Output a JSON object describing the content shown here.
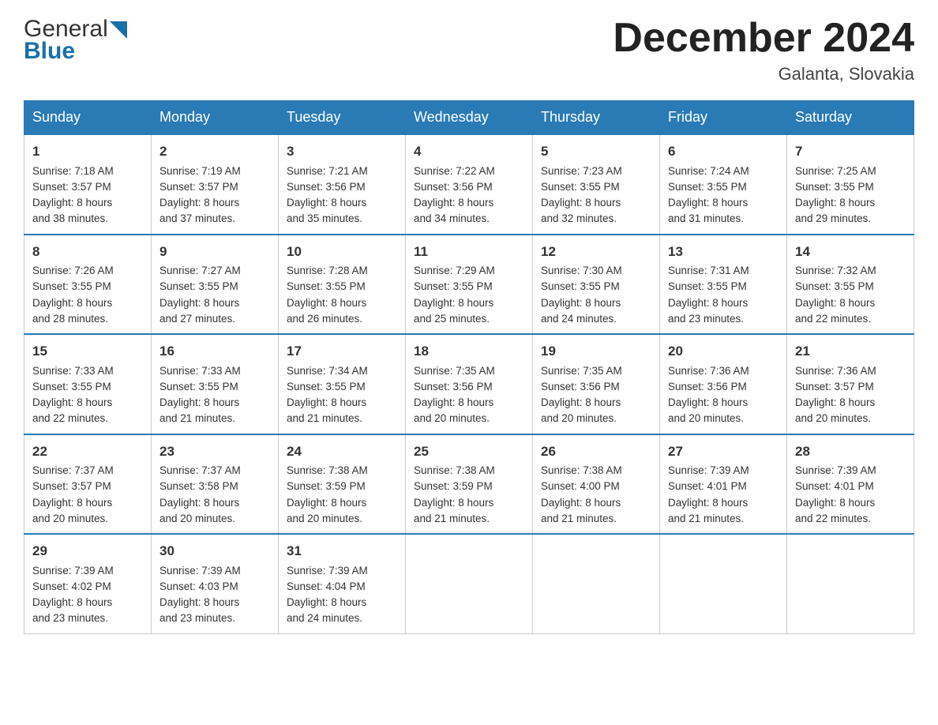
{
  "header": {
    "logo_general": "General",
    "logo_blue": "Blue",
    "month_title": "December 2024",
    "location": "Galanta, Slovakia"
  },
  "weekdays": [
    "Sunday",
    "Monday",
    "Tuesday",
    "Wednesday",
    "Thursday",
    "Friday",
    "Saturday"
  ],
  "weeks": [
    [
      {
        "day": "1",
        "sunrise": "7:18 AM",
        "sunset": "3:57 PM",
        "daylight": "8 hours and 38 minutes."
      },
      {
        "day": "2",
        "sunrise": "7:19 AM",
        "sunset": "3:57 PM",
        "daylight": "8 hours and 37 minutes."
      },
      {
        "day": "3",
        "sunrise": "7:21 AM",
        "sunset": "3:56 PM",
        "daylight": "8 hours and 35 minutes."
      },
      {
        "day": "4",
        "sunrise": "7:22 AM",
        "sunset": "3:56 PM",
        "daylight": "8 hours and 34 minutes."
      },
      {
        "day": "5",
        "sunrise": "7:23 AM",
        "sunset": "3:55 PM",
        "daylight": "8 hours and 32 minutes."
      },
      {
        "day": "6",
        "sunrise": "7:24 AM",
        "sunset": "3:55 PM",
        "daylight": "8 hours and 31 minutes."
      },
      {
        "day": "7",
        "sunrise": "7:25 AM",
        "sunset": "3:55 PM",
        "daylight": "8 hours and 29 minutes."
      }
    ],
    [
      {
        "day": "8",
        "sunrise": "7:26 AM",
        "sunset": "3:55 PM",
        "daylight": "8 hours and 28 minutes."
      },
      {
        "day": "9",
        "sunrise": "7:27 AM",
        "sunset": "3:55 PM",
        "daylight": "8 hours and 27 minutes."
      },
      {
        "day": "10",
        "sunrise": "7:28 AM",
        "sunset": "3:55 PM",
        "daylight": "8 hours and 26 minutes."
      },
      {
        "day": "11",
        "sunrise": "7:29 AM",
        "sunset": "3:55 PM",
        "daylight": "8 hours and 25 minutes."
      },
      {
        "day": "12",
        "sunrise": "7:30 AM",
        "sunset": "3:55 PM",
        "daylight": "8 hours and 24 minutes."
      },
      {
        "day": "13",
        "sunrise": "7:31 AM",
        "sunset": "3:55 PM",
        "daylight": "8 hours and 23 minutes."
      },
      {
        "day": "14",
        "sunrise": "7:32 AM",
        "sunset": "3:55 PM",
        "daylight": "8 hours and 22 minutes."
      }
    ],
    [
      {
        "day": "15",
        "sunrise": "7:33 AM",
        "sunset": "3:55 PM",
        "daylight": "8 hours and 22 minutes."
      },
      {
        "day": "16",
        "sunrise": "7:33 AM",
        "sunset": "3:55 PM",
        "daylight": "8 hours and 21 minutes."
      },
      {
        "day": "17",
        "sunrise": "7:34 AM",
        "sunset": "3:55 PM",
        "daylight": "8 hours and 21 minutes."
      },
      {
        "day": "18",
        "sunrise": "7:35 AM",
        "sunset": "3:56 PM",
        "daylight": "8 hours and 20 minutes."
      },
      {
        "day": "19",
        "sunrise": "7:35 AM",
        "sunset": "3:56 PM",
        "daylight": "8 hours and 20 minutes."
      },
      {
        "day": "20",
        "sunrise": "7:36 AM",
        "sunset": "3:56 PM",
        "daylight": "8 hours and 20 minutes."
      },
      {
        "day": "21",
        "sunrise": "7:36 AM",
        "sunset": "3:57 PM",
        "daylight": "8 hours and 20 minutes."
      }
    ],
    [
      {
        "day": "22",
        "sunrise": "7:37 AM",
        "sunset": "3:57 PM",
        "daylight": "8 hours and 20 minutes."
      },
      {
        "day": "23",
        "sunrise": "7:37 AM",
        "sunset": "3:58 PM",
        "daylight": "8 hours and 20 minutes."
      },
      {
        "day": "24",
        "sunrise": "7:38 AM",
        "sunset": "3:59 PM",
        "daylight": "8 hours and 20 minutes."
      },
      {
        "day": "25",
        "sunrise": "7:38 AM",
        "sunset": "3:59 PM",
        "daylight": "8 hours and 21 minutes."
      },
      {
        "day": "26",
        "sunrise": "7:38 AM",
        "sunset": "4:00 PM",
        "daylight": "8 hours and 21 minutes."
      },
      {
        "day": "27",
        "sunrise": "7:39 AM",
        "sunset": "4:01 PM",
        "daylight": "8 hours and 21 minutes."
      },
      {
        "day": "28",
        "sunrise": "7:39 AM",
        "sunset": "4:01 PM",
        "daylight": "8 hours and 22 minutes."
      }
    ],
    [
      {
        "day": "29",
        "sunrise": "7:39 AM",
        "sunset": "4:02 PM",
        "daylight": "8 hours and 23 minutes."
      },
      {
        "day": "30",
        "sunrise": "7:39 AM",
        "sunset": "4:03 PM",
        "daylight": "8 hours and 23 minutes."
      },
      {
        "day": "31",
        "sunrise": "7:39 AM",
        "sunset": "4:04 PM",
        "daylight": "8 hours and 24 minutes."
      },
      null,
      null,
      null,
      null
    ]
  ],
  "labels": {
    "sunrise": "Sunrise:",
    "sunset": "Sunset:",
    "daylight": "Daylight:"
  }
}
